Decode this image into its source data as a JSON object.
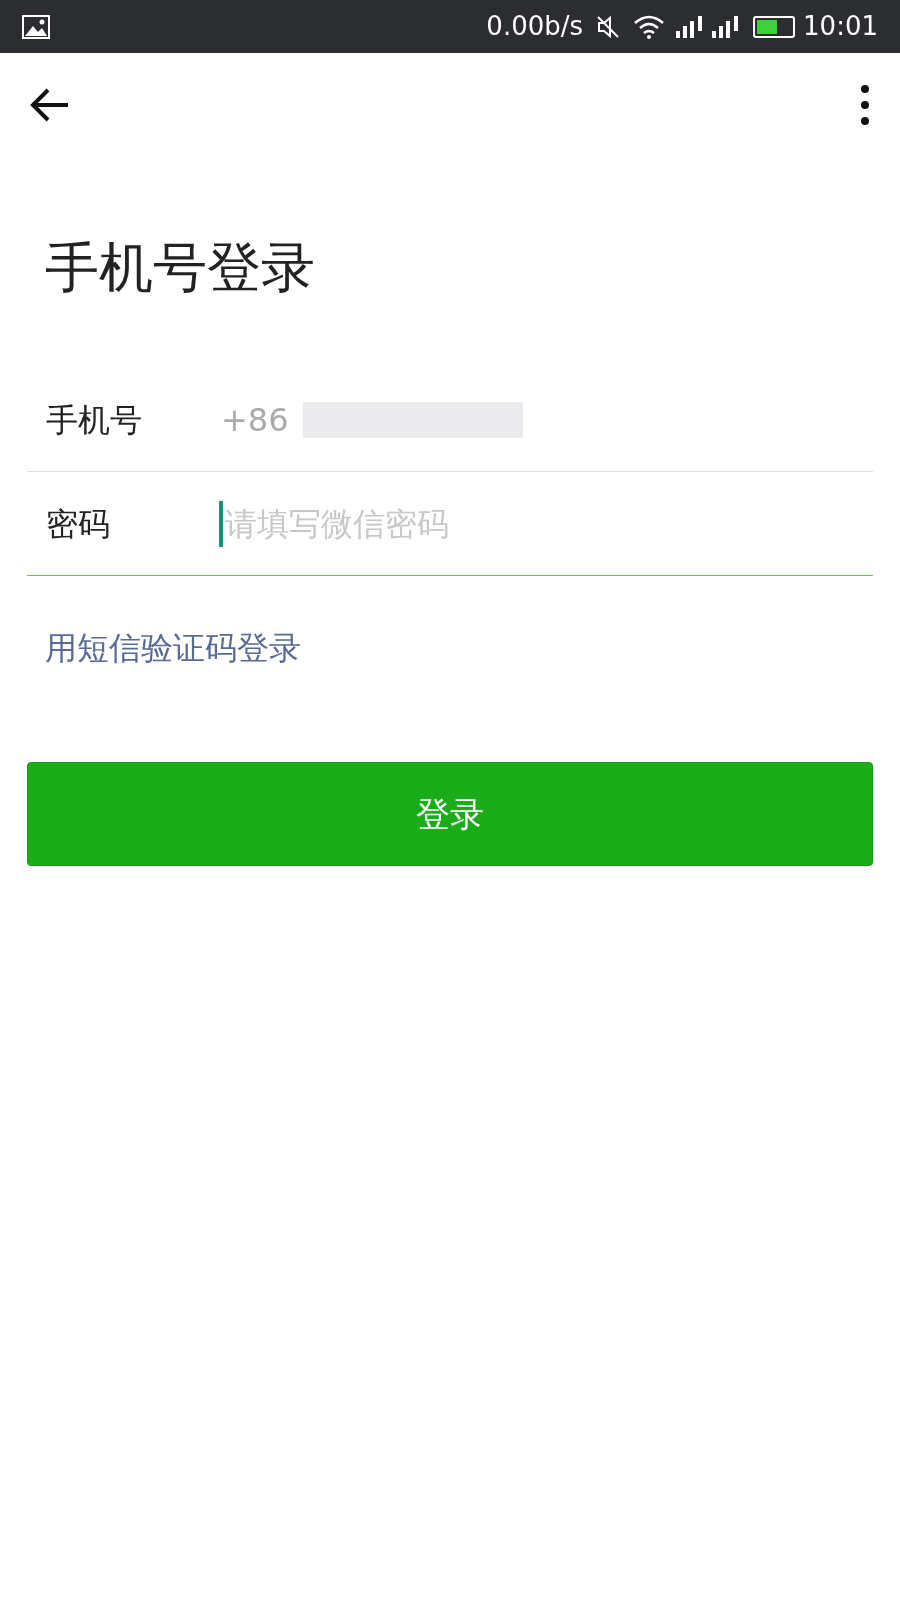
{
  "status_bar": {
    "net_speed": "0.00b/s",
    "time": "10:01",
    "battery": {
      "level": 0.6
    }
  },
  "title": "手机号登录",
  "fields": [
    {
      "label": "手机号",
      "value": "+86",
      "redacted": true,
      "focused": false
    },
    {
      "label": "密码",
      "placeholder": "请填写微信密码",
      "redacted": false,
      "focused": true
    }
  ],
  "sms_link": "用短信验证码登录",
  "login_button": "登录"
}
